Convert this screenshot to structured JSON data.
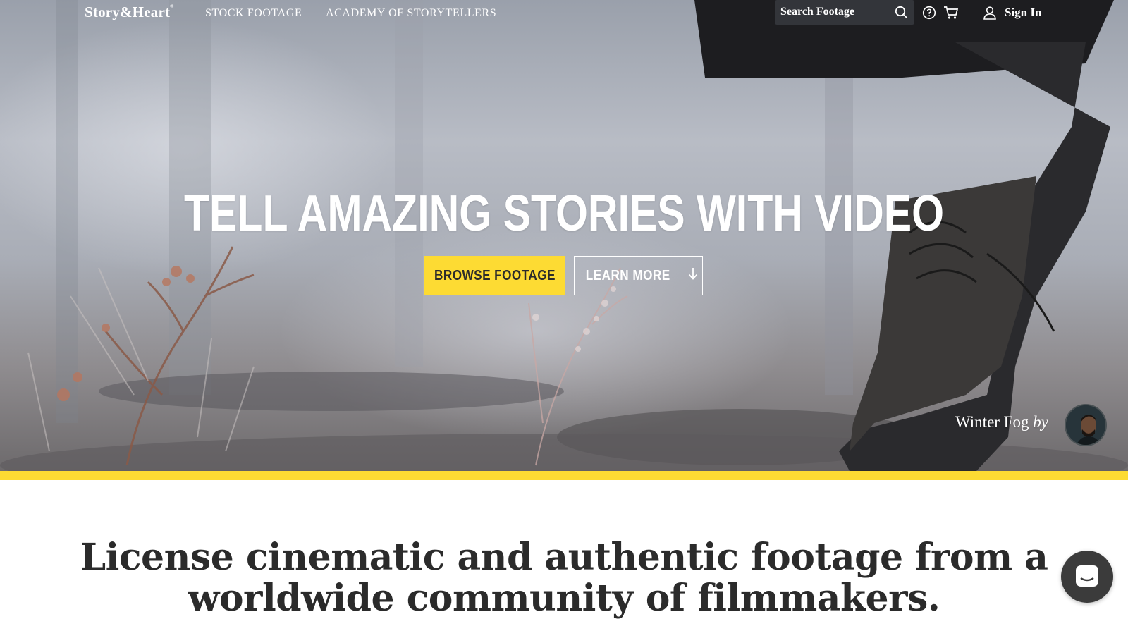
{
  "nav": {
    "logo": "Story&Heart",
    "logo_mark": "®",
    "links": [
      "STOCK FOOTAGE",
      "ACADEMY OF STORYTELLERS"
    ],
    "search_placeholder": "Search Footage",
    "sign_in": "Sign In",
    "icons": [
      "search-icon",
      "help-icon",
      "cart-icon",
      "user-icon"
    ]
  },
  "hero": {
    "title": "TELL AMAZING STORIES WITH VIDEO",
    "primary_button": "BROWSE FOOTAGE",
    "secondary_button": "LEARN MORE",
    "secondary_icon": "arrow-down-icon",
    "credit_title": "Winter Fog",
    "credit_by": "by"
  },
  "section": {
    "headline_line1": "License cinematic and authentic footage from a",
    "headline_line2": "worldwide community of filmmakers."
  },
  "colors": {
    "accent": "#fddb33",
    "text": "#2b2b2b",
    "chat": "#3b3b3b"
  }
}
